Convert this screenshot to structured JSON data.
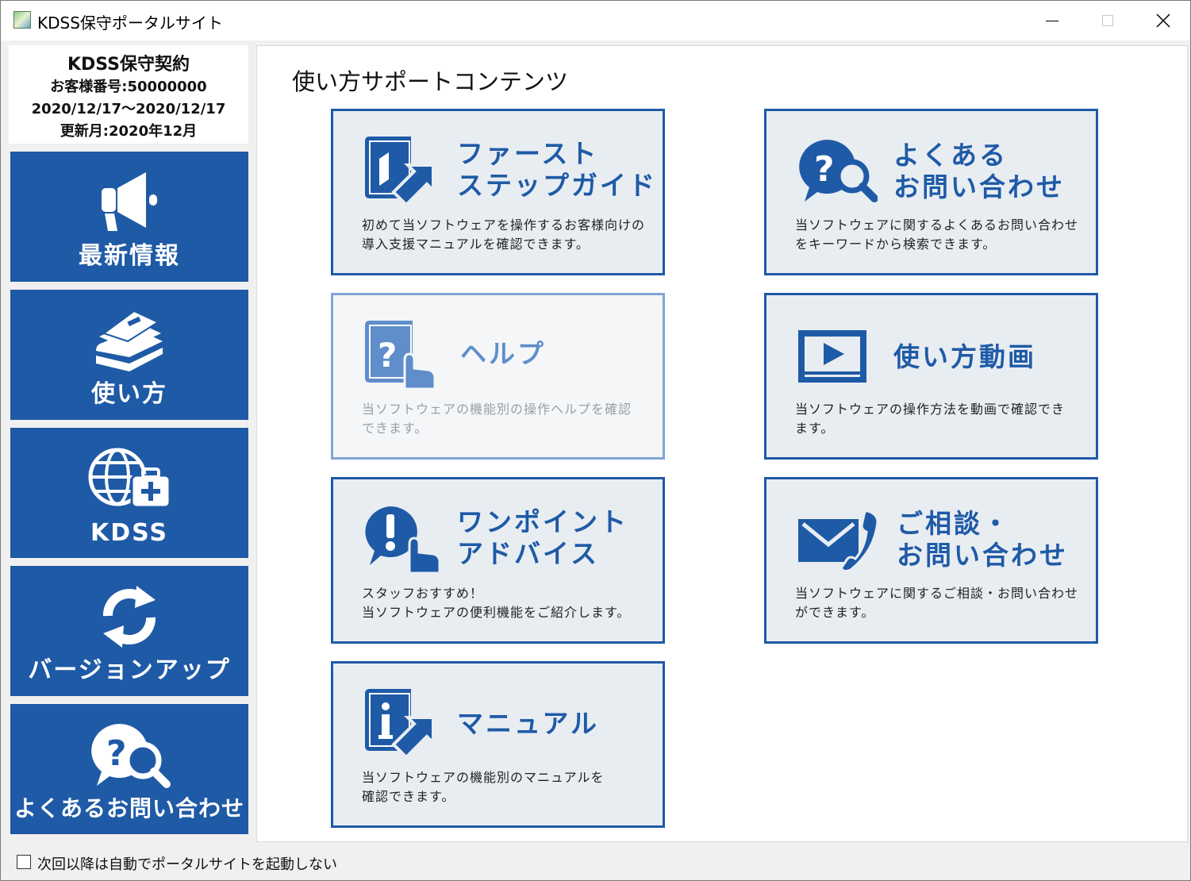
{
  "window": {
    "title": "KDSS保守ポータルサイト",
    "icons": {
      "app": "app-icon",
      "minimize": "minimize-icon",
      "maximize": "maximize-icon",
      "close": "close-icon"
    }
  },
  "contract": {
    "title": "KDSS保守契約",
    "customer_number": "お客様番号:50000000",
    "period": "2020/12/17～2020/12/17",
    "renewal": "更新月:2020年12月"
  },
  "sidebar": {
    "items": [
      {
        "label": "最新情報",
        "icon": "megaphone-icon"
      },
      {
        "label": "使い方",
        "icon": "books-icon"
      },
      {
        "label": "KDSS",
        "icon": "globe-medkit-icon"
      },
      {
        "label": "バージョンアップ",
        "icon": "refresh-icon"
      },
      {
        "label": "よくあるお問い合わせ",
        "icon": "faq-search-icon"
      }
    ]
  },
  "main": {
    "title": "使い方サポートコンテンツ",
    "cards": [
      {
        "title_line1": "ファースト",
        "title_line2": "ステップガイド",
        "desc_line1": "初めて当ソフトウェアを操作するお客様向けの",
        "desc_line2": "導入支援マニュアルを確認できます。",
        "icon": "book-arrow-icon",
        "enabled": true
      },
      {
        "title_line1": "よくある",
        "title_line2": "お問い合わせ",
        "desc_line1": "当ソフトウェアに関するよくあるお問い合わせ",
        "desc_line2": "をキーワードから検索できます。",
        "icon": "faq-search-icon",
        "enabled": true
      },
      {
        "title_line1": "ヘルプ",
        "title_line2": "",
        "desc_line1": "当ソフトウェアの機能別の操作ヘルプを確認",
        "desc_line2": "できます。",
        "icon": "help-book-icon",
        "enabled": false
      },
      {
        "title_line1": "使い方動画",
        "title_line2": "",
        "desc_line1": "当ソフトウェアの操作方法を動画で確認でき",
        "desc_line2": "ます。",
        "icon": "video-play-icon",
        "enabled": true
      },
      {
        "title_line1": "ワンポイント",
        "title_line2": "アドバイス",
        "desc_line1": "スタッフおすすめ！",
        "desc_line2": "当ソフトウェアの便利機能をご紹介します。",
        "icon": "exclamation-hand-icon",
        "enabled": true
      },
      {
        "title_line1": "ご相談・",
        "title_line2": "お問い合わせ",
        "desc_line1": "当ソフトウェアに関するご相談・お問い合わせ",
        "desc_line2": "ができます。",
        "icon": "mail-phone-icon",
        "enabled": true
      },
      {
        "title_line1": "マニュアル",
        "title_line2": "",
        "desc_line1": "当ソフトウェアの機能別のマニュアルを",
        "desc_line2": "確認できます。",
        "icon": "info-book-icon",
        "enabled": true
      }
    ]
  },
  "footer": {
    "checkbox_label": "次回以降は自動でポータルサイトを起動しない",
    "checked": false
  },
  "colors": {
    "accent": "#1f5aa6",
    "card_bg": "#e8edf2",
    "disabled_border": "#7fa6d6"
  }
}
